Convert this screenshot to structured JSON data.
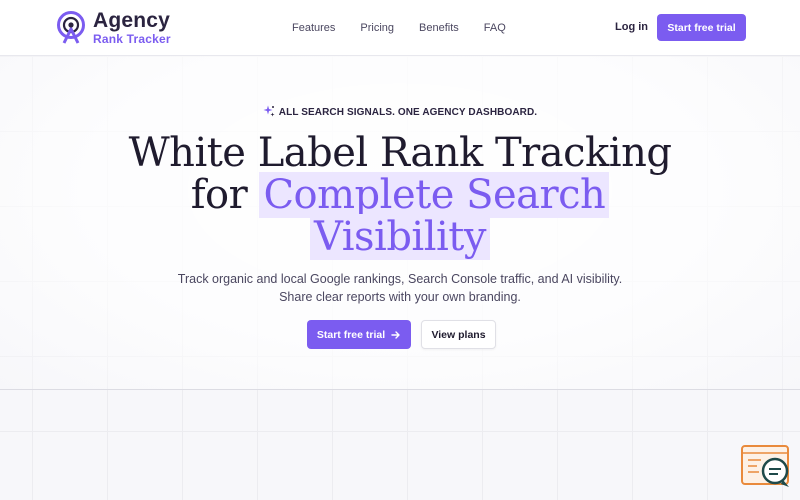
{
  "brand": {
    "name": "Agency",
    "sub": "Rank Tracker",
    "accent": "#7b5cf0"
  },
  "nav": {
    "items": [
      "Features",
      "Pricing",
      "Benefits",
      "FAQ"
    ]
  },
  "header": {
    "login": "Log in",
    "cta": "Start free trial"
  },
  "hero": {
    "eyebrow": "ALL SEARCH SIGNALS. ONE AGENCY DASHBOARD.",
    "title_line1": "White Label Rank Tracking",
    "title_for": "for",
    "title_hl1": "Complete Search",
    "title_hl2": "Visibility",
    "subtitle_line1": "Track organic and local Google rankings, Search Console traffic, and AI visibility.",
    "subtitle_line2": "Share clear reports with your own branding.",
    "cta_primary": "Start free trial",
    "cta_secondary": "View plans"
  },
  "icons": {
    "logo": "target-pin-icon",
    "eyebrow": "sparkle-icon",
    "cta_arrow": "arrow-right-icon",
    "chat": "chat-support-icon"
  }
}
